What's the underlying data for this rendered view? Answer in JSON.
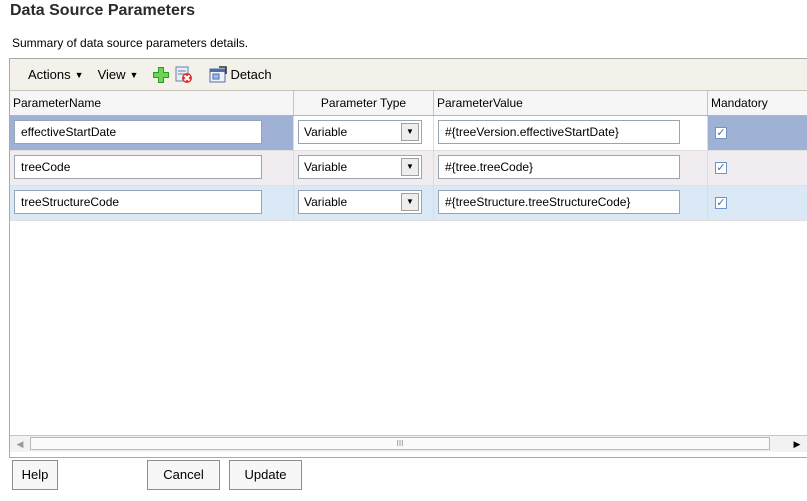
{
  "page": {
    "title": "Data Source Parameters",
    "subtitle": "Summary of data source parameters details."
  },
  "toolbar": {
    "actions_label": "Actions",
    "view_label": "View",
    "add_icon": "add-icon",
    "delete_icon": "delete-icon",
    "detach_label": "Detach"
  },
  "table": {
    "columns": [
      "ParameterName",
      "Parameter Type",
      "ParameterValue",
      "Mandatory"
    ],
    "rows": [
      {
        "name": "effectiveStartDate",
        "type": "Variable",
        "value": "#{treeVersion.effectiveStartDate}",
        "mandatory": true
      },
      {
        "name": "treeCode",
        "type": "Variable",
        "value": "#{tree.treeCode}",
        "mandatory": true
      },
      {
        "name": "treeStructureCode",
        "type": "Variable",
        "value": "#{treeStructure.treeStructureCode}",
        "mandatory": true
      }
    ]
  },
  "scrollbar": {
    "thumb_grip": "III"
  },
  "buttons": {
    "help": "Help",
    "cancel": "Cancel",
    "update": "Update"
  },
  "colors": {
    "selected_row": "#9fb2d6",
    "row2": "#f1ecef",
    "row3": "#dbe8f6",
    "toolbar_bg": "#f3f1e9"
  }
}
